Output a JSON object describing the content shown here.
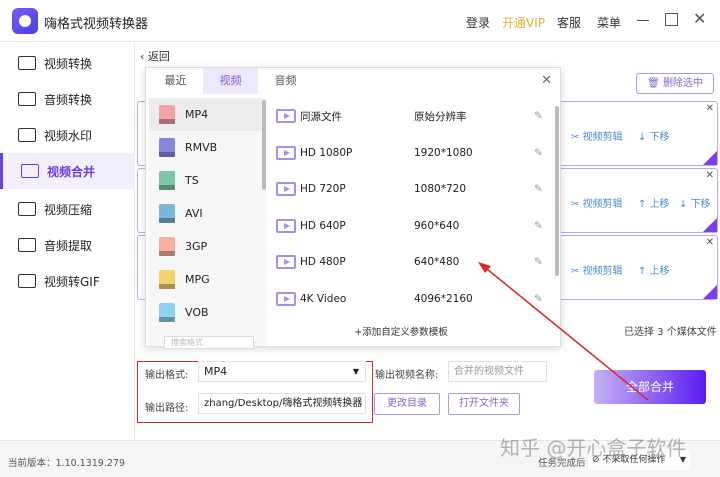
{
  "app": {
    "title": "嗨格式视频转换器",
    "login": "登录",
    "vip": "开通VIP",
    "service": "客服",
    "menu": "菜单"
  },
  "sidebar": {
    "items": [
      {
        "label": "视频转换"
      },
      {
        "label": "音频转换"
      },
      {
        "label": "视频水印"
      },
      {
        "label": "视频合并",
        "active": true
      },
      {
        "label": "视频压缩"
      },
      {
        "label": "音频提取"
      },
      {
        "label": "视频转GIF"
      }
    ]
  },
  "main": {
    "back": "返回",
    "delete_selected": "删除选中",
    "selected_count": "已选择 3 个媒体文件",
    "merge_all": "全部合并",
    "cards": [
      {
        "edit": "视频剪辑",
        "down": "下移"
      },
      {
        "edit": "视频剪辑",
        "up": "上移",
        "down": "下移"
      },
      {
        "edit": "视频剪辑",
        "up": "上移"
      }
    ]
  },
  "dialog": {
    "tabs": [
      "最近",
      "视频",
      "音频"
    ],
    "active_tab": "视频",
    "formats": [
      {
        "name": "MP4",
        "color": "#f4a3a8"
      },
      {
        "name": "RMVB",
        "color": "#8a86e0"
      },
      {
        "name": "TS",
        "color": "#7cc7a8"
      },
      {
        "name": "AVI",
        "color": "#7ab7d8"
      },
      {
        "name": "3GP",
        "color": "#f5b0a0"
      },
      {
        "name": "MPG",
        "color": "#f2d56a"
      },
      {
        "name": "VOB",
        "color": "#8fd3ef"
      }
    ],
    "search_placeholder": "搜索格式",
    "presets": [
      {
        "name": "同源文件",
        "res": "原始分辨率"
      },
      {
        "name": "HD 1080P",
        "res": "1920*1080"
      },
      {
        "name": "HD 720P",
        "res": "1080*720"
      },
      {
        "name": "HD 640P",
        "res": "960*640"
      },
      {
        "name": "HD 480P",
        "res": "640*480"
      },
      {
        "name": "4K Video",
        "res": "4096*2160"
      }
    ],
    "add_template": "+添加自定义参数模板"
  },
  "form": {
    "format_label": "输出格式:",
    "format_value": "MP4",
    "path_label": "输出路径:",
    "path_value": "zhang/Desktop/嗨格式视频转换器",
    "name_label": "输出视频名称:",
    "name_placeholder": "合并的视频文件",
    "change_dir": "更改目录",
    "open_folder": "打开文件夹"
  },
  "status": {
    "version": "当前版本：1.10.1319.279",
    "after_task": "任务完成后",
    "after_value": "不采取任何操作"
  },
  "watermark": "知乎 @开心盒子软件"
}
